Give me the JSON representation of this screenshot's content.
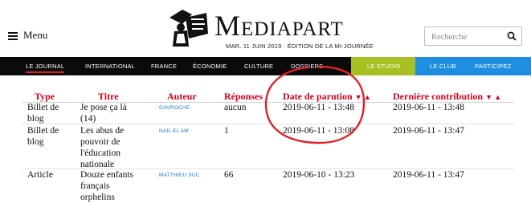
{
  "header": {
    "menu_label": "Menu",
    "logo_text": "Mediapart",
    "edition_line": "MAR. 11 JUIN 2019 · ÉDITION DE LA MI-JOURNÉE",
    "search_placeholder": "Recherche"
  },
  "nav": {
    "items": [
      "LE JOURNAL",
      "INTERNATIONAL",
      "FRANCE",
      "ÉCONOMIE",
      "CULTURE",
      "DOSSIERS"
    ],
    "studio": "LE STUDIO",
    "club": "LE CLUB",
    "participez": "PARTICIPEZ"
  },
  "table": {
    "headers": {
      "type": "Type",
      "title": "Titre",
      "author": "Auteur",
      "replies": "Réponses",
      "date": "Date de parution",
      "last": "Dernière contribution",
      "sort_arrows": "▼ ▲"
    },
    "rows": [
      {
        "type": [
          "Billet de",
          "blog"
        ],
        "title": [
          "Je pose ça là",
          "(14)"
        ],
        "author": "GAVROCHE.",
        "replies": "aucun",
        "date": "2019-06-11 - 13:48",
        "last": "2019-06-11 - 13:48"
      },
      {
        "type": [
          "Billet de",
          "blog"
        ],
        "title": [
          "Les abus de",
          "pouvoir de",
          "l'éducation",
          "nationale"
        ],
        "author": "NAIL EL AM",
        "replies": "1",
        "date": "2019-06-11 - 13:08",
        "last": "2019-06-11 - 13:47"
      },
      {
        "type": [
          "Article"
        ],
        "title": [
          "Douze enfants",
          "français",
          "orphelins"
        ],
        "author": "MATTHIEU SUC",
        "replies": "66",
        "date": "2019-06-10 - 13:23",
        "last": "2019-06-11 - 13:47"
      }
    ]
  },
  "colors": {
    "accent_red": "#d0021b",
    "studio_green": "#a8c021",
    "club_blue": "#1e8fe0",
    "nav_black": "#0b0b0b",
    "author_blue": "#1877c9"
  }
}
